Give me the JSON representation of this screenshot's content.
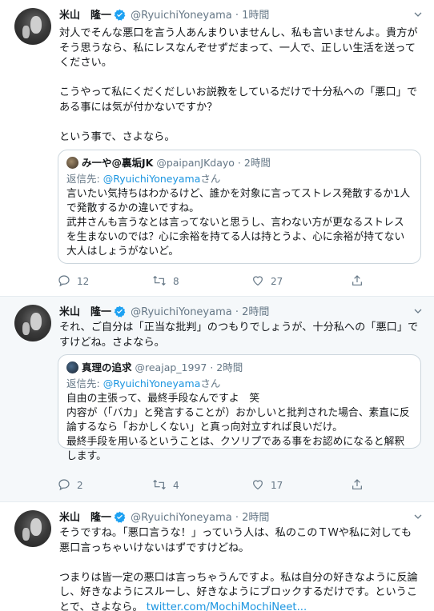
{
  "colors": {
    "link": "#1b95e0",
    "muted": "#657786",
    "border": "#e6ecf0",
    "verified": "#1da1f2"
  },
  "tweets": [
    {
      "name": "米山　隆一",
      "handle": "@RyuichiYoneyama",
      "dot": "·",
      "time": "1時間",
      "text": "対人でそんな悪口を言う人あんまりいませんし、私も言いませんよ。貴方がそう思うなら、私にレスなんぞせずだまって、一人で、正しい生活を送ってください。\n\nこうやって私にくだくだしいお説教をしているだけで十分私への「悪口」である事には気が付かないですか？\n\nという事で、さよなら。",
      "quote": {
        "name": "み一や@裏垢JK",
        "handle": "@paipanJKdayo",
        "dot": "·",
        "time": "2時間",
        "reply_prefix": "返信先: ",
        "reply_handle": "@RyuichiYoneyama",
        "reply_suffix": "さん",
        "text": "言いたい気持ちはわかるけど、誰かを対象に言ってストレス発散するか1人で発散するかの違いですね。\n武井さんも言うなとは言ってないと思うし、言わない方が更なるストレスを生まないのでは？心に余裕を持てる人は持とうよ、心に余裕が持てない大人はしょうがないど。"
      },
      "replies": "12",
      "retweets": "8",
      "likes": "27"
    },
    {
      "name": "米山　隆一",
      "handle": "@RyuichiYoneyama",
      "dot": "·",
      "time": "2時間",
      "text": "それ、ご自分は「正当な批判」のつもりでしょうが、十分私への「悪口」ですけどね。さよなら。",
      "quote": {
        "name": "真理の追求",
        "handle": "@reajap_1997",
        "dot": "·",
        "time": "2時間",
        "reply_prefix": "返信先: ",
        "reply_handle": "@RyuichiYoneyama",
        "reply_suffix": "さん",
        "text": "自由の主張って、最終手段なんですよ　笑\n内容が（「バカ」と発言することが）おかしいと批判された場合、素直に反論するなら「おかしくない」と真っ向対立すれば良いだけ。\n最終手段を用いるということは、クソリプである事をお認めになると解釈します。"
      },
      "replies": "2",
      "retweets": "4",
      "likes": "17"
    },
    {
      "name": "米山　隆一",
      "handle": "@RyuichiYoneyama",
      "dot": "·",
      "time": "2時間",
      "text": "そうですね。「悪口言うな！」っていう人は、私のこのＴＷや私に対しても悪口言っちゃいけないはずですけどね。\n\nつまりは皆一定の悪口は言っちゃうんですよ。私は自分の好きなように反論し、好きなようにスルーし、好きなようにブロックするだけです。ということで、さよなら。 ",
      "link": "twitter.com/MochiMochiNeet..."
    }
  ]
}
